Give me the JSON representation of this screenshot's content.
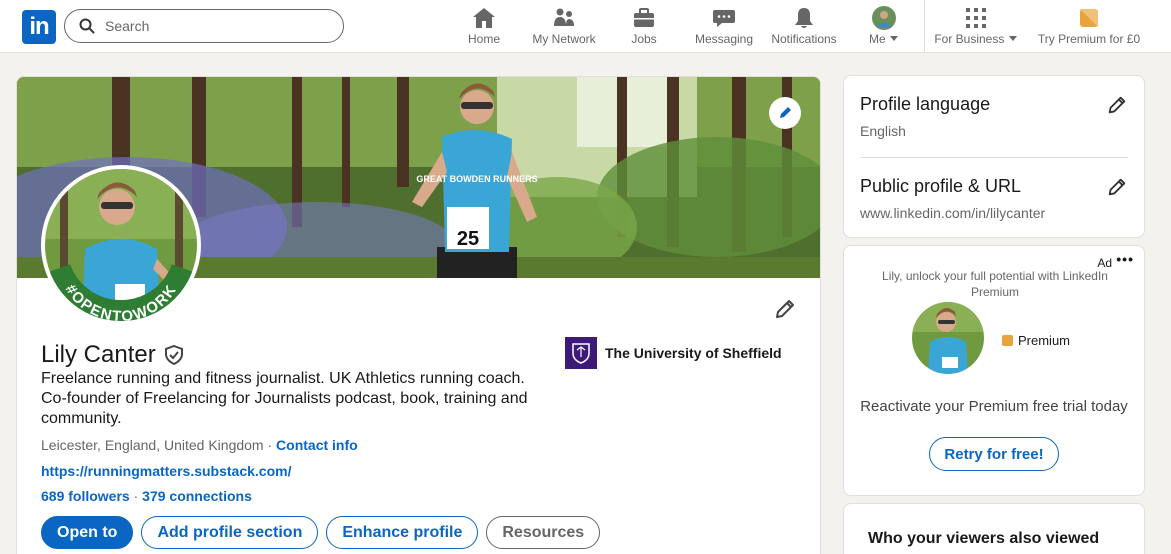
{
  "nav": {
    "logo": "in",
    "search_placeholder": "Search",
    "items": [
      {
        "label": "Home",
        "icon": "home-icon"
      },
      {
        "label": "My Network",
        "icon": "network-icon"
      },
      {
        "label": "Jobs",
        "icon": "briefcase-icon"
      },
      {
        "label": "Messaging",
        "icon": "message-icon"
      },
      {
        "label": "Notifications",
        "icon": "bell-icon"
      },
      {
        "label": "Me",
        "icon": "avatar-icon"
      },
      {
        "label": "For Business",
        "icon": "grid-icon"
      },
      {
        "label": "Try Premium for £0",
        "icon": "premium-icon"
      }
    ]
  },
  "profile": {
    "open_to_work_badge": "#OPENTOWORK",
    "name": "Lily Canter",
    "headline": "Freelance running and fitness journalist. UK Athletics running coach. Co-founder of Freelancing for Journalists podcast, book, training and community.",
    "location": "Leicester, England, United Kingdom",
    "separator": " · ",
    "contact_info": "Contact info",
    "website": "https://runningmatters.substack.com/",
    "followers": "689 followers",
    "connections_sep": " · ",
    "connections": "379 connections",
    "education": "The University of Sheffield",
    "buttons": {
      "open_to": "Open to",
      "add_section": "Add profile section",
      "enhance": "Enhance profile",
      "resources": "Resources"
    },
    "cover_text": {
      "shirt": "GREAT BOWDEN RUNNERS",
      "race_number": "25"
    }
  },
  "sidebar": {
    "profile_language": {
      "title": "Profile language",
      "value": "English"
    },
    "public_profile": {
      "title": "Public profile & URL",
      "value": "www.linkedin.com/in/lilycanter"
    },
    "ad": {
      "label": "Ad",
      "more": "•••",
      "text": "Lily, unlock your full potential with LinkedIn Premium",
      "premium_label": "Premium",
      "reactivate": "Reactivate your Premium free trial today",
      "cta": "Retry for free!"
    },
    "viewers": {
      "title": "Who your viewers also viewed"
    }
  },
  "colors": {
    "brand": "#0a66c2",
    "open_to_work_green": "#2e7d32",
    "premium_gold": "#e7a33e",
    "sheffield_purple": "#3d1a78"
  }
}
